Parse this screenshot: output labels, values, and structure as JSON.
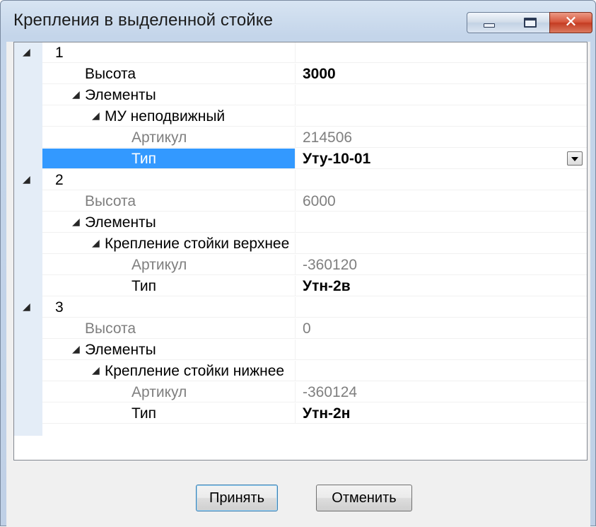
{
  "window": {
    "title": "Крепления в выделенной стойке"
  },
  "tree": {
    "rows": [
      {
        "level": 0,
        "expander": "◢",
        "label": "1",
        "value": "",
        "label_grey": false,
        "value_style": "normal"
      },
      {
        "level": 1,
        "expander": "",
        "label": "Высота",
        "value": "3000",
        "label_grey": false,
        "value_style": "bold"
      },
      {
        "level": 1,
        "expander": "◢",
        "label": "Элементы",
        "value": "",
        "label_grey": false,
        "value_style": "normal"
      },
      {
        "level": 2,
        "expander": "◢",
        "label": "МУ неподвижный",
        "value": "",
        "label_grey": false,
        "value_style": "normal"
      },
      {
        "level": 3,
        "expander": "",
        "label": "Артикул",
        "value": "214506",
        "label_grey": true,
        "value_style": "grey"
      },
      {
        "level": 3,
        "expander": "",
        "label": "Тип",
        "value": "Уту-10-01",
        "label_grey": false,
        "value_style": "bold",
        "selected": true,
        "dropdown": true
      },
      {
        "level": 0,
        "expander": "◢",
        "label": "2",
        "value": "",
        "label_grey": false,
        "value_style": "normal"
      },
      {
        "level": 1,
        "expander": "",
        "label": "Высота",
        "value": "6000",
        "label_grey": true,
        "value_style": "grey"
      },
      {
        "level": 1,
        "expander": "◢",
        "label": "Элементы",
        "value": "",
        "label_grey": false,
        "value_style": "normal"
      },
      {
        "level": 2,
        "expander": "◢",
        "label": "Крепление стойки верхнее",
        "value": "",
        "label_grey": false,
        "value_style": "normal"
      },
      {
        "level": 3,
        "expander": "",
        "label": "Артикул",
        "value": "-360120",
        "label_grey": true,
        "value_style": "grey"
      },
      {
        "level": 3,
        "expander": "",
        "label": "Тип",
        "value": "Утн-2в",
        "label_grey": false,
        "value_style": "bold"
      },
      {
        "level": 0,
        "expander": "◢",
        "label": "3",
        "value": "",
        "label_grey": false,
        "value_style": "normal"
      },
      {
        "level": 1,
        "expander": "",
        "label": "Высота",
        "value": "0",
        "label_grey": true,
        "value_style": "grey"
      },
      {
        "level": 1,
        "expander": "◢",
        "label": "Элементы",
        "value": "",
        "label_grey": false,
        "value_style": "normal"
      },
      {
        "level": 2,
        "expander": "◢",
        "label": "Крепление стойки нижнее",
        "value": "",
        "label_grey": false,
        "value_style": "normal"
      },
      {
        "level": 3,
        "expander": "",
        "label": "Артикул",
        "value": "-360124",
        "label_grey": true,
        "value_style": "grey"
      },
      {
        "level": 3,
        "expander": "",
        "label": "Тип",
        "value": "Утн-2н",
        "label_grey": false,
        "value_style": "bold"
      }
    ]
  },
  "buttons": {
    "accept_label": "Принять",
    "cancel_label": "Отменить"
  },
  "colors": {
    "selection": "#3399ff",
    "grey_text": "#7f7f7f",
    "close_button": "#c43b22"
  },
  "icons": {
    "expander": "triangle-expanded-icon",
    "dropdown": "chevron-down-icon",
    "minimize": "minimize-icon",
    "maximize": "maximize-icon",
    "close": "close-icon"
  }
}
